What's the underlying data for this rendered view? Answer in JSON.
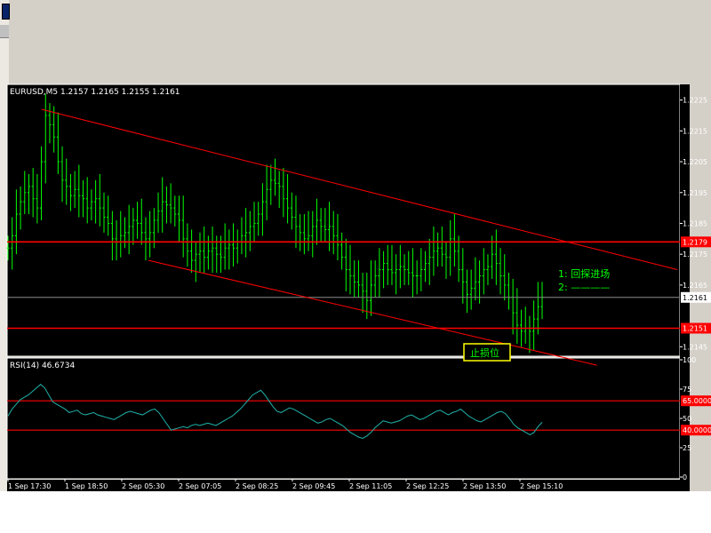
{
  "chart_data": [
    {
      "type": "candlestick",
      "symbol_line": "EURUSD,M5  1.2157 1.2165 1.2155 1.2161",
      "y_ticks": [
        "1.2225",
        "1.2215",
        "1.2205",
        "1.2195",
        "1.2185",
        "1.2175",
        "1.2165",
        "1.2145"
      ],
      "ylim": [
        1.21425,
        1.22295
      ],
      "horizontal_levels": [
        {
          "value": 1.2179,
          "label": "1.2179",
          "color": "#ff0000"
        },
        {
          "value": 1.2151,
          "label": "1.2151",
          "color": "#ff0000"
        }
      ],
      "current_price": {
        "value": 1.2161,
        "label": "1.2161"
      },
      "channel": {
        "upper": [
          {
            "t": 0.05,
            "y": 1.2222
          },
          {
            "t": 1.0,
            "y": 1.217
          }
        ],
        "lower": [
          {
            "t": 0.21,
            "y": 1.2173
          },
          {
            "t": 0.88,
            "y": 1.2139
          }
        ]
      },
      "annotations": {
        "note1": "1: 回探进场",
        "note2": "2: ————",
        "stop_loss": "止损位"
      },
      "price_series": [
        1.2177,
        1.2181,
        1.2188,
        1.2192,
        1.2195,
        1.2197,
        1.2193,
        1.219,
        1.2205,
        1.222,
        1.2217,
        1.2213,
        1.2205,
        1.2199,
        1.2197,
        1.2194,
        1.2196,
        1.2194,
        1.2193,
        1.219,
        1.2192,
        1.2193,
        1.219,
        1.2187,
        1.2185,
        1.218,
        1.2179,
        1.2181,
        1.2182,
        1.2184,
        1.2186,
        1.2185,
        1.2182,
        1.218,
        1.2182,
        1.2186,
        1.2189,
        1.2192,
        1.2191,
        1.219,
        1.2188,
        1.2186,
        1.218,
        1.2176,
        1.2173,
        1.2175,
        1.2176,
        1.2174,
        1.2176,
        1.2177,
        1.2175,
        1.2174,
        1.2177,
        1.2178,
        1.2177,
        1.2179,
        1.2181,
        1.2182,
        1.2184,
        1.2185,
        1.2188,
        1.2192,
        1.2196,
        1.2199,
        1.2198,
        1.2197,
        1.2193,
        1.219,
        1.2187,
        1.2184,
        1.2182,
        1.218,
        1.2181,
        1.2184,
        1.2186,
        1.2184,
        1.2183,
        1.2184,
        1.2181,
        1.2178,
        1.2174,
        1.217,
        1.2168,
        1.2166,
        1.2165,
        1.2163,
        1.216,
        1.2165,
        1.2168,
        1.217,
        1.2172,
        1.217,
        1.2169,
        1.217,
        1.2171,
        1.217,
        1.2169,
        1.2168,
        1.2168,
        1.217,
        1.2172,
        1.2174,
        1.2176,
        1.2177,
        1.2175,
        1.2174,
        1.218,
        1.2176,
        1.217,
        1.2166,
        1.2162,
        1.2164,
        1.2166,
        1.2168,
        1.217,
        1.2171,
        1.2175,
        1.2172,
        1.2168,
        1.2165,
        1.2161,
        1.2156,
        1.2152,
        1.215,
        1.2151,
        1.215,
        1.2154,
        1.2158,
        1.2161
      ],
      "x_ticks": [
        "1 Sep 17:30",
        "1 Sep 18:50",
        "2 Sep 05:30",
        "2 Sep 07:05",
        "2 Sep 08:25",
        "2 Sep 09:45",
        "2 Sep 11:05",
        "2 Sep 12:25",
        "2 Sep 13:50",
        "2 Sep 15:10"
      ]
    },
    {
      "type": "line",
      "indicator_label": "RSI(14)  46.6734",
      "ylim": [
        0,
        100
      ],
      "y_ticks": [
        "100",
        "75",
        "50",
        "25",
        "0"
      ],
      "levels": [
        {
          "value": 65.0,
          "label": "65.0000"
        },
        {
          "value": 40.0,
          "label": "40.0000"
        }
      ],
      "rsi_series": [
        52,
        58,
        62,
        66,
        68,
        70,
        73,
        76,
        79,
        76,
        70,
        64,
        62,
        60,
        58,
        55,
        56,
        57,
        54,
        53,
        54,
        55,
        53,
        52,
        51,
        50,
        49,
        51,
        53,
        55,
        56,
        55,
        54,
        53,
        55,
        57,
        58,
        55,
        50,
        45,
        40,
        41,
        42,
        43,
        42,
        44,
        45,
        44,
        45,
        46,
        45,
        44,
        46,
        48,
        50,
        52,
        55,
        58,
        62,
        66,
        70,
        72,
        74,
        70,
        65,
        60,
        56,
        55,
        57,
        59,
        58,
        56,
        54,
        52,
        50,
        48,
        46,
        47,
        49,
        50,
        48,
        46,
        44,
        41,
        38,
        36,
        34,
        33,
        35,
        38,
        42,
        45,
        48,
        47,
        46,
        47,
        48,
        50,
        52,
        53,
        51,
        49,
        50,
        52,
        54,
        56,
        57,
        55,
        53,
        55,
        56,
        58,
        55,
        52,
        50,
        48,
        47,
        49,
        51,
        53,
        55,
        56,
        54,
        50,
        45,
        42,
        40,
        38,
        36,
        38,
        43,
        46.7
      ]
    }
  ]
}
